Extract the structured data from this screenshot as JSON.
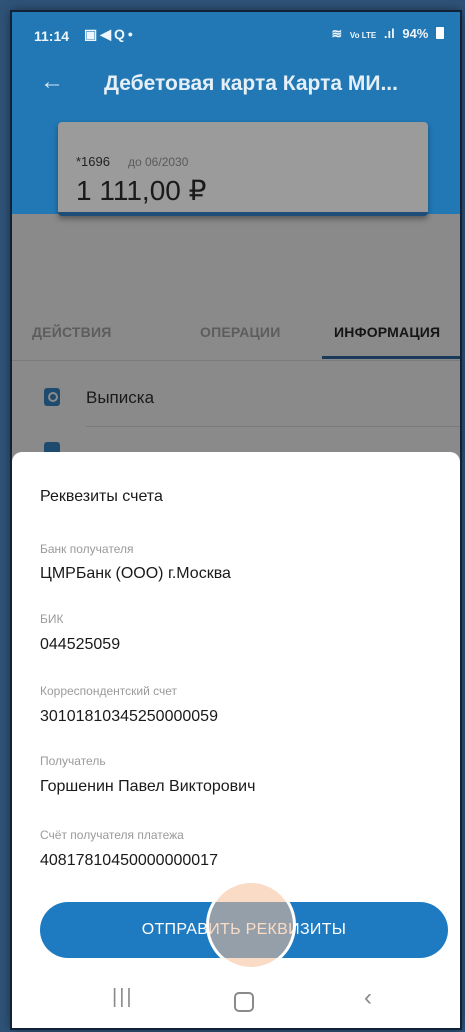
{
  "status_bar": {
    "time": "11:14",
    "icons": "▣◀Q•",
    "network": "Vo LTE",
    "battery": "94%"
  },
  "header": {
    "title": "Дебетовая карта Карта МИ..."
  },
  "card": {
    "number": "*1696",
    "expiry": "до 06/2030",
    "balance": "1 111,00 ₽"
  },
  "tabs": [
    {
      "label": "ДЕЙСТВИЯ"
    },
    {
      "label": "ОПЕРАЦИИ"
    },
    {
      "label": "ИНФОРМАЦИЯ",
      "active": true
    }
  ],
  "list": {
    "statement_label": "Выписка"
  },
  "sheet": {
    "title": "Реквезиты счета",
    "fields": [
      {
        "label": "Банк получателя",
        "value": "ЦМРБанк (ООО) г.Москва"
      },
      {
        "label": "БИК",
        "value": "044525059"
      },
      {
        "label": "Корреспондентский счет",
        "value": "30101810345250000059"
      },
      {
        "label": "Получатель",
        "value": "Горшенин Павел Викторович"
      },
      {
        "label": "Счёт получателя платежа",
        "value": "40817810450000000017"
      }
    ],
    "send_button": "ОТПРАВИТЬ РЕКВИЗИТЫ"
  },
  "navbar": {
    "recent": "|||",
    "back": "‹"
  },
  "colors": {
    "header_blue": "#2178b4",
    "button_blue": "#1f7bc1",
    "overlay_gray": "#8a8a8a",
    "touch_marker": "#f6be96"
  }
}
